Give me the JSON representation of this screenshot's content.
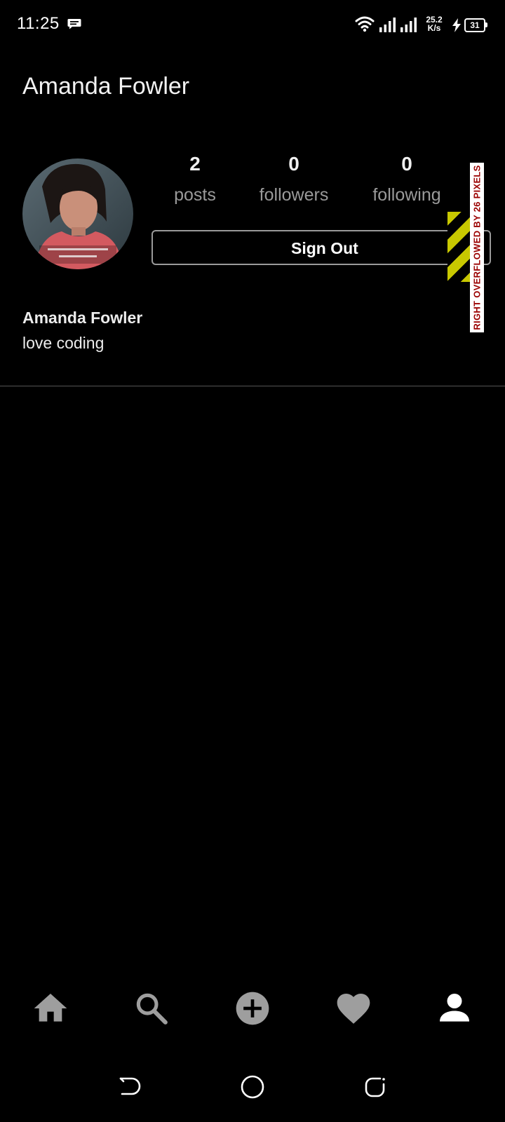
{
  "status_bar": {
    "time": "11:25",
    "net_speed_value": "25.2",
    "net_speed_unit": "K/s",
    "battery_level": "31",
    "icons": [
      "message-icon",
      "wifi-icon",
      "signal-icon",
      "signal-icon",
      "charging-icon",
      "battery-icon"
    ]
  },
  "app_bar": {
    "title": "Amanda Fowler"
  },
  "profile": {
    "stats": {
      "posts": {
        "value": "2",
        "label": "posts"
      },
      "followers": {
        "value": "0",
        "label": "followers"
      },
      "following": {
        "value": "0",
        "label": "following"
      }
    },
    "sign_out_label": "Sign Out",
    "name": "Amanda Fowler",
    "bio": "love coding"
  },
  "debug_overflow": {
    "label": "RIGHT OVERFLOWED BY 26 PIXELS",
    "stripe_color": "#c8c800",
    "text_color": "#9b0000"
  },
  "bottom_nav": {
    "items": [
      "home-icon",
      "search-icon",
      "add-post-icon",
      "heart-icon",
      "profile-icon"
    ],
    "active": "profile-icon",
    "active_color": "#ffffff",
    "inactive_color": "#9e9e9e"
  },
  "system_nav": {
    "items": [
      "back-icon",
      "home-circle-icon",
      "recent-apps-icon"
    ]
  }
}
